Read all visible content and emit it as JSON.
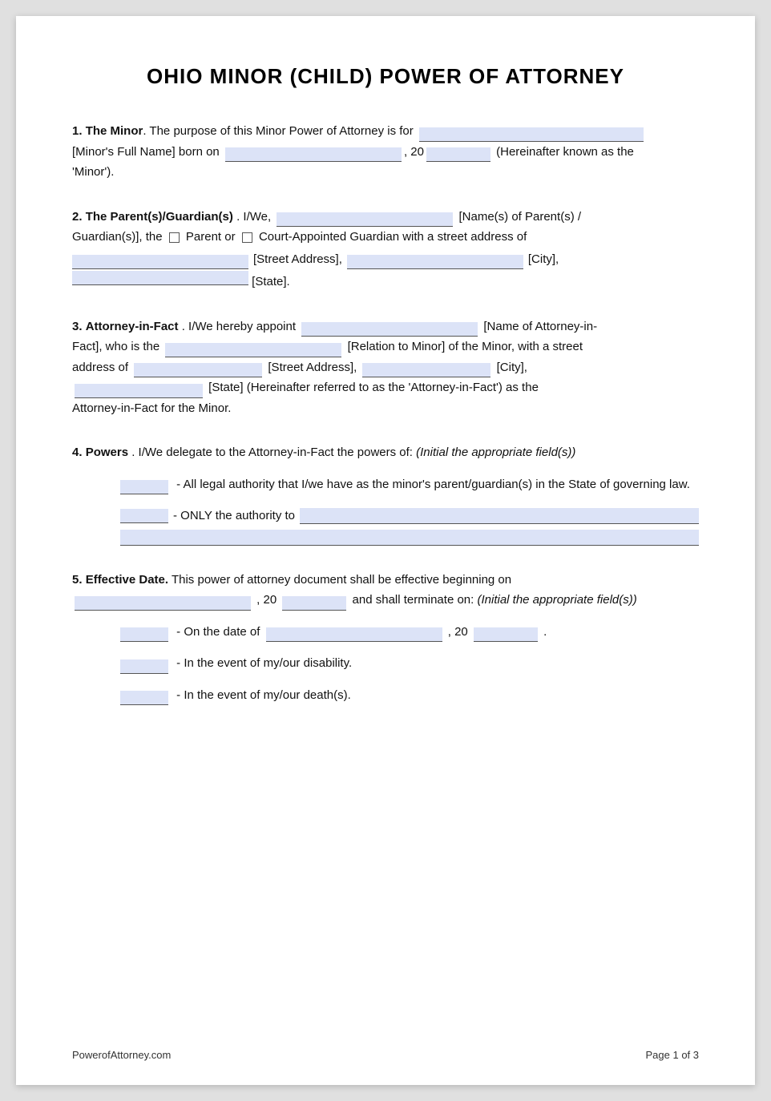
{
  "title": "OHIO MINOR (CHILD) POWER OF ATTORNEY",
  "sections": {
    "s1": {
      "label": "1.",
      "bold": "The Minor",
      "text1": ". The purpose of this Minor Power of Attorney is for",
      "text2": "[Minor's Full Name] born on",
      "text3": ", 20",
      "text4": "(Hereinafter known as the 'Minor')."
    },
    "s2": {
      "label": "2.",
      "bold": "The Parent(s)/Guardian(s)",
      "text1": ". I/We,",
      "text2": "[Name(s) of Parent(s) / Guardian(s)], the",
      "text3": "Parent or",
      "text4": "Court-Appointed Guardian with a street address of",
      "street_label": "[Street Address],",
      "city_label": "[City],",
      "state_label": "[State]."
    },
    "s3": {
      "label": "3.",
      "bold": "Attorney-in-Fact",
      "text1": ". I/We hereby appoint",
      "text2": "[Name of Attorney-in-Fact], who is the",
      "text3": "[Relation to Minor] of the Minor, with a street address of",
      "street_label": "[Street Address],",
      "city_label": "[City],",
      "state_label": "[State] (Hereinafter referred to as the 'Attorney-in-Fact') as the Attorney-in-Fact for the Minor."
    },
    "s4": {
      "label": "4.",
      "bold": "Powers",
      "text1": ". I/We delegate to the Attorney-in-Fact the powers of:",
      "italic": "(Initial the appropriate field(s))",
      "option1": "- All legal authority that I/we have as the minor's parent/guardian(s) in the State of governing law.",
      "option2_prefix": "- ONLY the authority to"
    },
    "s5": {
      "label": "5.",
      "bold": "Effective Date.",
      "text1": "This power of attorney document shall be effective beginning on",
      "text2": ", 20",
      "text3": "and shall terminate on:",
      "italic": "(Initial the appropriate field(s))",
      "opt1": "- On the date of",
      "opt1b": ", 20",
      "opt1c": ".",
      "opt2": "- In the event of my/our disability.",
      "opt3": "- In the event of my/our death(s)."
    }
  },
  "footer": {
    "website": "PowerofAttorney.com",
    "page_info": "Page 1 of 3"
  }
}
